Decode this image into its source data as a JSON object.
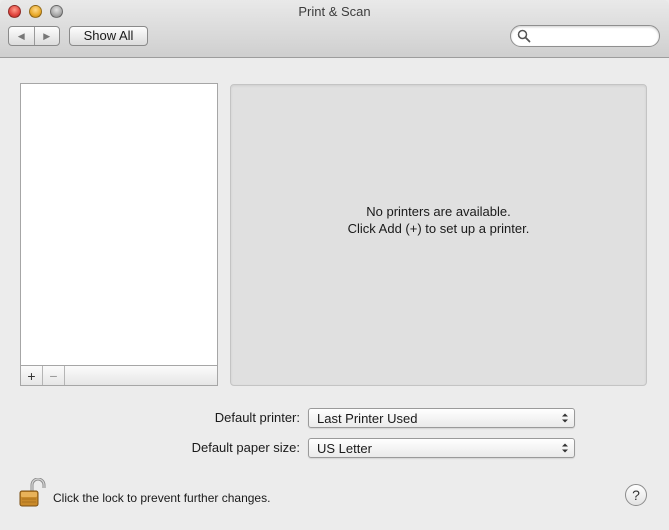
{
  "window": {
    "title": "Print & Scan"
  },
  "toolbar": {
    "back_icon": "chevron-left",
    "forward_icon": "chevron-right",
    "show_all_label": "Show All",
    "search": {
      "placeholder": "",
      "value": "",
      "icon": "search-icon"
    }
  },
  "printer_list": {
    "items": [],
    "add_label": "+",
    "remove_label": "−"
  },
  "detail": {
    "line1": "No printers are available.",
    "line2": "Click Add (+) to set up a printer."
  },
  "settings": {
    "default_printer_label": "Default printer:",
    "default_printer_value": "Last Printer Used",
    "paper_size_label": "Default paper size:",
    "paper_size_value": "US Letter"
  },
  "footer": {
    "lock_text": "Click the lock to prevent further changes.",
    "help_label": "?"
  },
  "colors": {
    "window_bg": "#ececec",
    "detail_bg": "#e0e0e0",
    "close": "#e0443e",
    "minimize": "#e8a92a",
    "zoom": "#a8a8a8"
  }
}
